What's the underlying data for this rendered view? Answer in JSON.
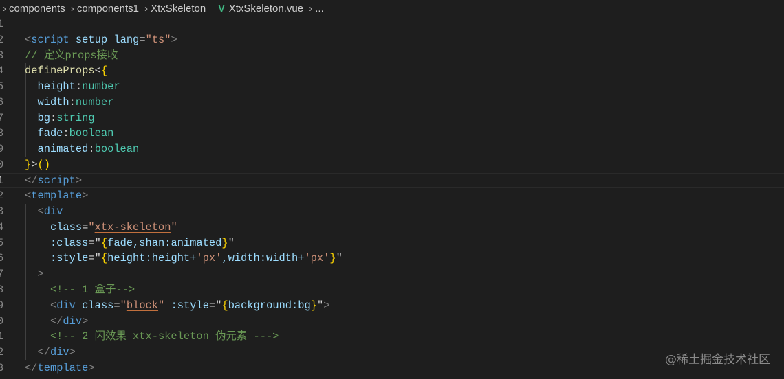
{
  "breadcrumb": {
    "items": [
      "components",
      "components1",
      "XtxSkeleton",
      "XtxSkeleton.vue",
      "..."
    ],
    "file_icon": "vue-icon"
  },
  "editor": {
    "current_line": 11,
    "lines": [
      {
        "n": "1",
        "tokens": []
      },
      {
        "n": "2",
        "tokens": [
          [
            "<",
            "br"
          ],
          [
            "script",
            "tag"
          ],
          [
            " ",
            "txt"
          ],
          [
            "setup",
            "attr"
          ],
          [
            " ",
            "txt"
          ],
          [
            "lang",
            "attr"
          ],
          [
            "=",
            "txt"
          ],
          [
            "\"ts\"",
            "str"
          ],
          [
            ">",
            "br"
          ]
        ]
      },
      {
        "n": "3",
        "tokens": [
          [
            "// 定义props接收",
            "cm"
          ]
        ]
      },
      {
        "n": "4",
        "tokens": [
          [
            "defineProps",
            "fn"
          ],
          [
            "<",
            "punc"
          ],
          [
            "{",
            "brace"
          ]
        ]
      },
      {
        "n": "5",
        "tokens": [
          [
            "  height",
            "var"
          ],
          [
            ":",
            "punc"
          ],
          [
            "number",
            "type"
          ]
        ]
      },
      {
        "n": "6",
        "tokens": [
          [
            "  width",
            "var"
          ],
          [
            ":",
            "punc"
          ],
          [
            "number",
            "type"
          ]
        ]
      },
      {
        "n": "7",
        "tokens": [
          [
            "  bg",
            "var"
          ],
          [
            ":",
            "punc"
          ],
          [
            "string",
            "type"
          ]
        ]
      },
      {
        "n": "8",
        "tokens": [
          [
            "  fade",
            "var"
          ],
          [
            ":",
            "punc"
          ],
          [
            "boolean",
            "type"
          ]
        ]
      },
      {
        "n": "9",
        "tokens": [
          [
            "  animated",
            "var"
          ],
          [
            ":",
            "punc"
          ],
          [
            "boolean",
            "type"
          ]
        ]
      },
      {
        "n": "0",
        "tokens": [
          [
            "}",
            "brace"
          ],
          [
            ">",
            "punc"
          ],
          [
            "()",
            "brace"
          ]
        ]
      },
      {
        "n": "1",
        "tokens": [
          [
            "</",
            "br"
          ],
          [
            "script",
            "tag"
          ],
          [
            ">",
            "br"
          ]
        ]
      },
      {
        "n": "2",
        "tokens": [
          [
            "<",
            "br"
          ],
          [
            "template",
            "tag"
          ],
          [
            ">",
            "br"
          ]
        ]
      },
      {
        "n": "3",
        "tokens": [
          [
            "  <",
            "br"
          ],
          [
            "div",
            "tag"
          ]
        ]
      },
      {
        "n": "4",
        "tokens": [
          [
            "    class",
            "attr"
          ],
          [
            "=",
            "txt"
          ],
          [
            "\"",
            "str"
          ],
          [
            "xtx-skeleton",
            "str ul"
          ],
          [
            "\"",
            "str"
          ]
        ]
      },
      {
        "n": "5",
        "tokens": [
          [
            "    :class",
            "attr"
          ],
          [
            "=\"",
            "txt"
          ],
          [
            "{",
            "brace"
          ],
          [
            "fade,shan:animated",
            "attr"
          ],
          [
            "}",
            "brace"
          ],
          [
            "\"",
            "txt"
          ]
        ]
      },
      {
        "n": "6",
        "tokens": [
          [
            "    :style",
            "attr"
          ],
          [
            "=\"",
            "txt"
          ],
          [
            "{",
            "brace"
          ],
          [
            "height:height+",
            "attr"
          ],
          [
            "'px'",
            "str"
          ],
          [
            ",width:width+",
            "attr"
          ],
          [
            "'px'",
            "str"
          ],
          [
            "}",
            "brace"
          ],
          [
            "\"",
            "txt"
          ]
        ]
      },
      {
        "n": "7",
        "tokens": [
          [
            "  >",
            "br"
          ]
        ]
      },
      {
        "n": "8",
        "tokens": [
          [
            "    <!-- 1 盒子-->",
            "cm"
          ]
        ]
      },
      {
        "n": "9",
        "tokens": [
          [
            "    <",
            "br"
          ],
          [
            "div",
            "tag"
          ],
          [
            " ",
            "txt"
          ],
          [
            "class",
            "attr"
          ],
          [
            "=",
            "txt"
          ],
          [
            "\"",
            "str"
          ],
          [
            "block",
            "str ul"
          ],
          [
            "\"",
            "str"
          ],
          [
            " ",
            "txt"
          ],
          [
            ":style",
            "attr"
          ],
          [
            "=\"",
            "txt"
          ],
          [
            "{",
            "brace"
          ],
          [
            "background:bg",
            "attr"
          ],
          [
            "}",
            "brace"
          ],
          [
            "\"",
            "txt"
          ],
          [
            ">",
            "br"
          ]
        ]
      },
      {
        "n": "0",
        "tokens": [
          [
            "    </",
            "br"
          ],
          [
            "div",
            "tag"
          ],
          [
            ">",
            "br"
          ]
        ]
      },
      {
        "n": "1",
        "tokens": [
          [
            "    <!-- 2 闪效果 xtx-skeleton 伪元素 --->",
            "cm"
          ]
        ]
      },
      {
        "n": "2",
        "tokens": [
          [
            "  </",
            "br"
          ],
          [
            "div",
            "tag"
          ],
          [
            ">",
            "br"
          ]
        ]
      },
      {
        "n": "3",
        "tokens": [
          [
            "</",
            "br"
          ],
          [
            "template",
            "tag"
          ],
          [
            ">",
            "br"
          ]
        ]
      }
    ]
  },
  "watermark": "@稀土掘金技术社区"
}
